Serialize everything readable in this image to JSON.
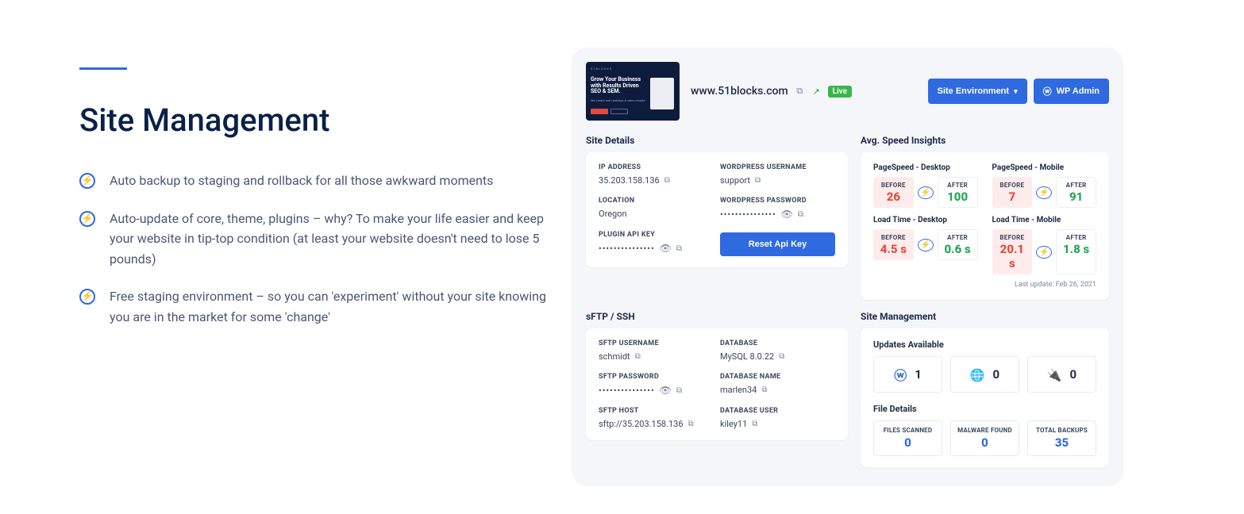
{
  "left": {
    "title": "Site Management",
    "bullets": [
      "Auto backup to staging and rollback for all those awkward moments",
      "Auto-update of core, theme, plugins – why? To make your life easier and keep your website in tip-top condition (at least your website doesn't need to lose 5 pounds)",
      "Free staging environment – so you can 'experiment' without your site knowing you are in the market for some 'change'"
    ]
  },
  "dash": {
    "thumb": {
      "brand": "51BLOCKS",
      "headline": "Grow Your Business with Results Driven SEO & SEM.",
      "sub": "We create real rankings & sales results"
    },
    "domain": "www.51blocks.com",
    "live_badge": "Live",
    "env_btn": "Site Environment",
    "admin_btn": "WP Admin",
    "site_details_title": "Site Details",
    "site_details": {
      "ip_label": "IP ADDRESS",
      "ip": "35.203.158.136",
      "wp_user_label": "WORDPRESS USERNAME",
      "wp_user": "support",
      "location_label": "LOCATION",
      "location": "Oregon",
      "wp_pass_label": "WORDPRESS PASSWORD",
      "wp_pass": "•••••••••••••••",
      "api_label": "PLUGIN API KEY",
      "api": "•••••••••••••••",
      "reset_btn": "Reset Api Key"
    },
    "speed_title": "Avg. Speed Insights",
    "speed": {
      "before_tag": "BEFORE",
      "after_tag": "AFTER",
      "ps_desktop_title": "PageSpeed - Desktop",
      "ps_desktop_before": "26",
      "ps_desktop_after": "100",
      "ps_mobile_title": "PageSpeed - Mobile",
      "ps_mobile_before": "7",
      "ps_mobile_after": "91",
      "lt_desktop_title": "Load Time - Desktop",
      "lt_desktop_before": "4.5 s",
      "lt_desktop_after": "0.6 s",
      "lt_mobile_title": "Load Time - Mobile",
      "lt_mobile_before": "20.1 s",
      "lt_mobile_after": "1.8 s",
      "last_update": "Last update: Feb 26, 2021"
    },
    "sftp_title": "sFTP / SSH",
    "sftp": {
      "user_label": "SFTP USERNAME",
      "user": "schmidt",
      "db_label": "DATABASE",
      "db": "MySQL 8.0.22",
      "pass_label": "SFTP PASSWORD",
      "pass": "•••••••••••••••",
      "dbname_label": "DATABASE NAME",
      "dbname": "marlen34",
      "host_label": "SFTP HOST",
      "host": "sftp://35.203.158.136",
      "dbuser_label": "DATABASE USER",
      "dbuser": "kiley11"
    },
    "mgmt_title": "Site Management",
    "mgmt": {
      "updates_title": "Updates Available",
      "wordpress_count": "1",
      "themes_count": "0",
      "plugins_count": "0",
      "files_title": "File Details",
      "scanned_label": "FILES SCANNED",
      "scanned": "0",
      "malware_label": "MALWARE FOUND",
      "malware": "0",
      "backups_label": "TOTAL BACKUPS",
      "backups": "35"
    }
  }
}
